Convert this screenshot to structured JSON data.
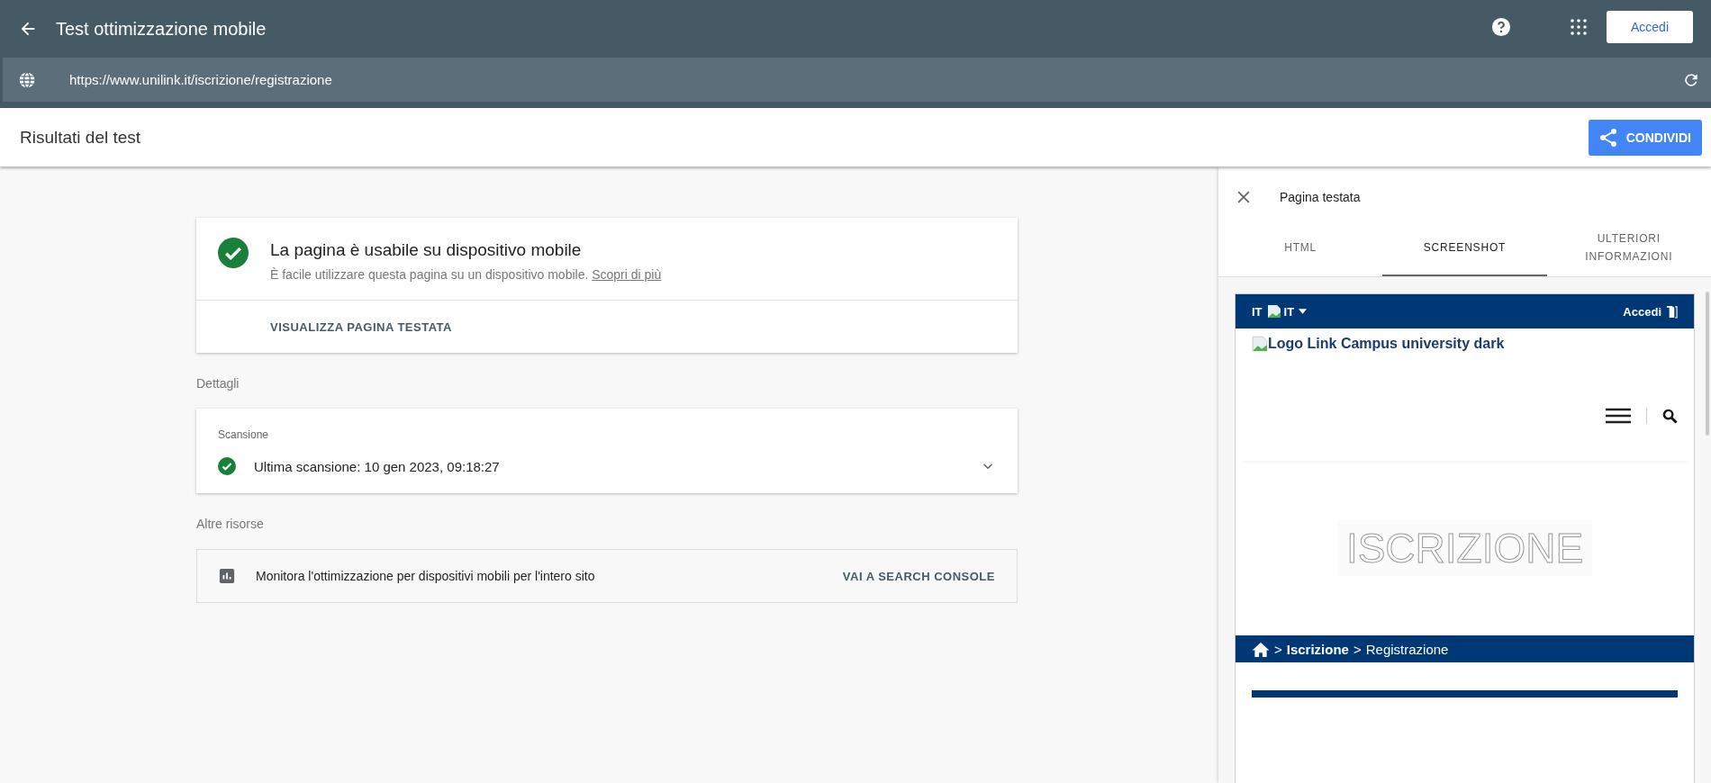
{
  "app_bar": {
    "title": "Test ottimizzazione mobile",
    "sign_in_button": "Accedi"
  },
  "url_bar": {
    "url": "https://www.unilink.it/iscrizione/registrazione"
  },
  "results_header": {
    "title": "Risultati del test",
    "share_button": "CONDIVIDI"
  },
  "result_card": {
    "title": "La pagina è usabile su dispositivo mobile",
    "description": "È facile utilizzare questa pagina su un dispositivo mobile.",
    "link": "Scopri di più",
    "action": "VISUALIZZA PAGINA TESTATA"
  },
  "details": {
    "heading": "Dettagli",
    "card_title": "Scansione",
    "crawl_status": "Ultima scansione: 10 gen 2023, 09:18:27",
    "expanded": false
  },
  "other_resources": {
    "heading": "Altre risorse",
    "text": "Monitora l'ottimizzazione per dispositivi mobili per l'intero sito",
    "action": "VAI A SEARCH CONSOLE"
  },
  "side_panel": {
    "title": "Pagina testata",
    "tabs": [
      {
        "label": "HTML",
        "selected": false
      },
      {
        "label": "SCREENSHOT",
        "selected": true
      },
      {
        "label": "ULTERIORI INFORMAZIONI",
        "selected": false
      }
    ],
    "screenshot": {
      "language": "IT",
      "flag_alt": "IT",
      "sign_in": "Accedi",
      "logo_alt": "Logo Link Campus university dark",
      "banner": "ISCRIZIONE",
      "breadcrumb": [
        {
          "separator": ">",
          "label": "Iscrizione",
          "current": false
        },
        {
          "separator": ">",
          "label": "Registrazione",
          "current": true
        }
      ]
    }
  }
}
